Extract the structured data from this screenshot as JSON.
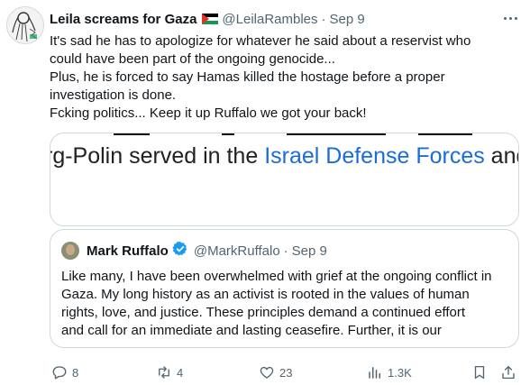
{
  "tweet": {
    "author_name": "Leila screams for Gaza",
    "handle": "@LeilaRambles",
    "separator": "·",
    "date": "Sep 9",
    "lines": [
      "It's sad he has to apologize for whatever he said about a reservist who",
      "could have been part of the ongoing genocide...",
      "Plus, he is forced to say Hamas killed the hostage before a proper",
      "investigation is done.",
      "Fcking politics... Keep it up Ruffalo we got your back!"
    ]
  },
  "media": {
    "text_before": "rg-Polin served in the ",
    "text_link": "Israel Defense Forces",
    "text_after": " and"
  },
  "quote": {
    "author_name": "Mark Ruffalo",
    "handle": "@MarkRuffalo",
    "separator": "·",
    "date": "Sep 9",
    "lines": [
      "Like many, I have been overwhelmed with grief at the ongoing conflict in",
      "Gaza. My long history as an activist is rooted in the values of human",
      "rights, love, and justice. These principles demand a continued effort",
      "and call for an immediate and lasting ceasefire. Further, it is our"
    ]
  },
  "actions": {
    "replies": "8",
    "reposts": "4",
    "likes": "23",
    "views": "1.3K"
  },
  "colors": {
    "text": "#0f1419",
    "muted": "#536471",
    "border": "#cfd9de",
    "link": "#1a6dd6",
    "verified": "#1d9bf0"
  },
  "icons": [
    "avatar",
    "palestine-flag",
    "more-icon",
    "verified-badge-icon",
    "reply-icon",
    "repost-icon",
    "like-icon",
    "views-icon",
    "bookmark-icon",
    "share-icon"
  ]
}
